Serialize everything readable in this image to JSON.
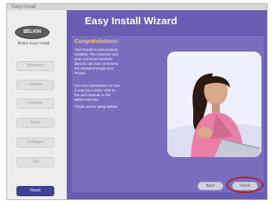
{
  "window": {
    "top_strip_label": "Easy Install"
  },
  "sidebar": {
    "logo_text": "BELKIN",
    "tagline": "Belkin Easy Install",
    "steps": [
      {
        "label": "Welcome"
      },
      {
        "label": "Choose"
      },
      {
        "label": "Connect"
      },
      {
        "label": "Setup"
      },
      {
        "label": "Configure"
      },
      {
        "label": "Test"
      },
      {
        "label": "Finish"
      }
    ],
    "active_step_index": 6
  },
  "main": {
    "title": "Easy Install Wizard",
    "heading": "Congratulations!",
    "paragraphs": [
      "Your Router is now properly installed. The computer and your connected wireless devices can now connect to the Internet through your Router.",
      "For more information on how to use your router, refer to the user manual on the Belkin web site.",
      "Thank you for using Belkin!"
    ],
    "buttons": {
      "back": "Back",
      "finish": "Finish"
    }
  },
  "colors": {
    "main_background": "#6a5bb3",
    "panel_background": "#7a6cbe",
    "title_text": "#ffffff",
    "heading_text": "#f0c878",
    "highlight_ring": "#b02020",
    "active_step": "#3f4196"
  },
  "icons": [
    "belkin-logo-icon",
    "woman-photo-image"
  ]
}
